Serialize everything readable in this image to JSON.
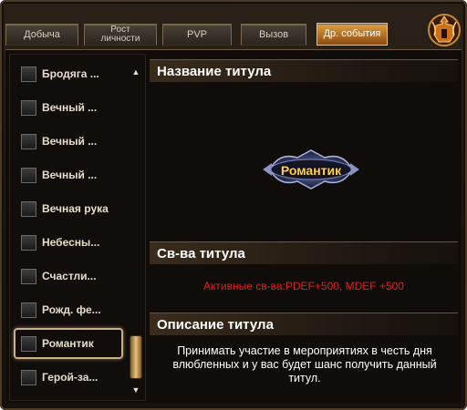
{
  "tabs": [
    {
      "label": "Добыча"
    },
    {
      "label": "Рост\nличности"
    },
    {
      "label": "PVP"
    },
    {
      "label": "Вызов"
    },
    {
      "label": "Др. события",
      "active": true
    }
  ],
  "sidebar": {
    "items": [
      {
        "label": "Бродяга ..."
      },
      {
        "label": "Вечный ..."
      },
      {
        "label": "Вечный ..."
      },
      {
        "label": "Вечный ..."
      },
      {
        "label": "Вечная рука"
      },
      {
        "label": "Небесны..."
      },
      {
        "label": "Счастли..."
      },
      {
        "label": "Рожд. фе..."
      },
      {
        "label": "Романтик",
        "selected": true
      },
      {
        "label": "Герой-за..."
      }
    ]
  },
  "title_section": {
    "header": "Название титула",
    "badge": "Романтик"
  },
  "props_section": {
    "header": "Св-ва титула",
    "text": "Активные св-ва:PDEF+500, MDEF +500"
  },
  "desc_section": {
    "header": "Описание титула",
    "text": "Принимать участие в мероприятиях в честь дня влюбленных и у вас будет шанс получить данный титул."
  },
  "colors": {
    "accent": "#e0a040",
    "props_text": "#e02020",
    "badge_text": "#ffd24a"
  },
  "icons": {
    "logo": "warrior-helmet-icon",
    "scroll_up": "arrow-up-icon",
    "scroll_down": "arrow-down-icon"
  }
}
